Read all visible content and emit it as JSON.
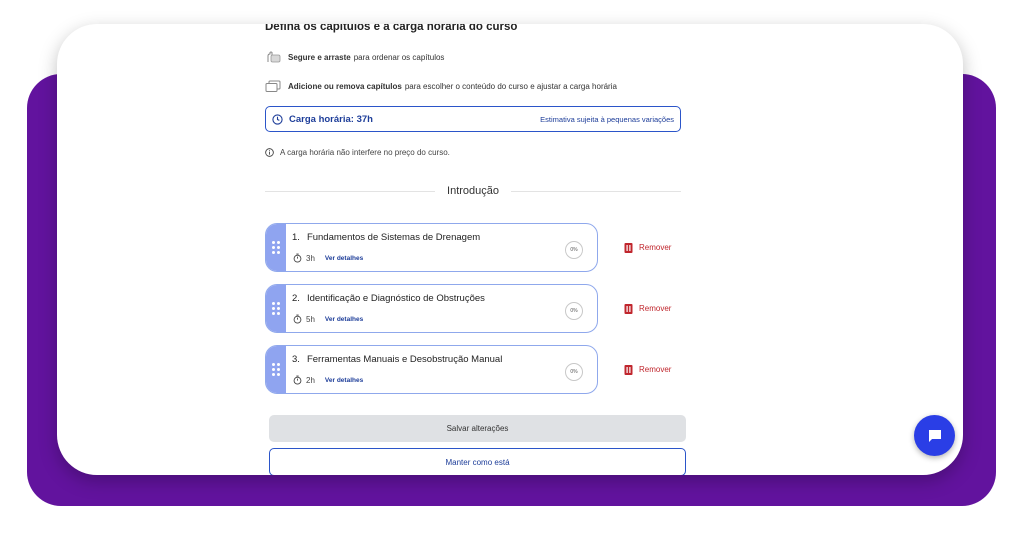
{
  "page": {
    "heading": "Defina os capítulos e a carga horária do curso"
  },
  "tips": [
    {
      "icon": "drag-hand-icon",
      "bold": "Segure e arraste",
      "text": "para ordenar os capítulos"
    },
    {
      "icon": "stack-icon",
      "bold": "Adicione ou remova capítulos",
      "text": "para escolher o conteúdo do curso e ajustar a carga horária"
    }
  ],
  "workload": {
    "label": "Carga horária: 37h",
    "estimate": "Estimativa sujeita à pequenas variações"
  },
  "note": "A carga horária não interfere no preço do curso.",
  "section": {
    "title": "Introdução"
  },
  "chapters": [
    {
      "number": "1.",
      "title": "Fundamentos de Sistemas de Drenagem",
      "hours": "3h",
      "details": "Ver detalhes",
      "progress": "0%",
      "remove": "Remover"
    },
    {
      "number": "2.",
      "title": "Identificação e Diagnóstico de Obstruções",
      "hours": "5h",
      "details": "Ver detalhes",
      "progress": "0%",
      "remove": "Remover"
    },
    {
      "number": "3.",
      "title": "Ferramentas Manuais e Desobstrução Manual",
      "hours": "2h",
      "details": "Ver detalhes",
      "progress": "0%",
      "remove": "Remover"
    }
  ],
  "actions": {
    "save": "Salvar alterações",
    "keep": "Manter como está"
  },
  "colors": {
    "frame": "#62139e",
    "accent": "#2b55c9",
    "handle": "#8fa4f0",
    "danger": "#c0262d",
    "fab": "#2a3ee6"
  }
}
